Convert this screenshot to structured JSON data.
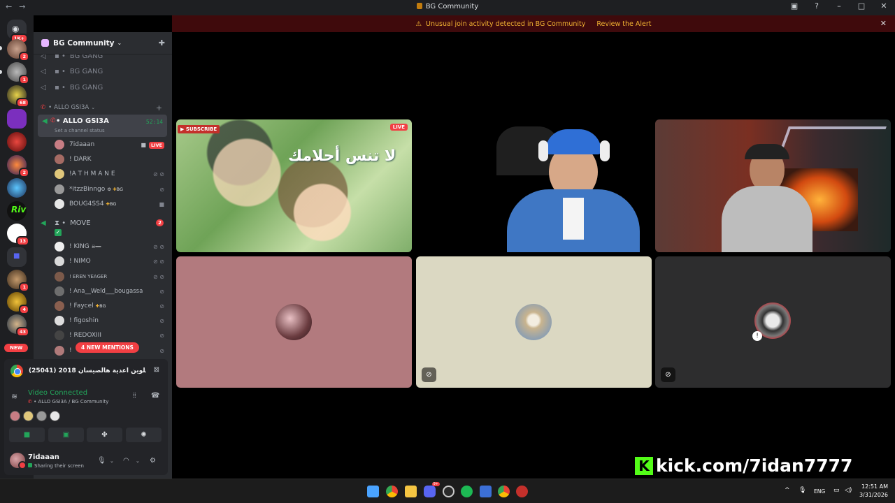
{
  "window": {
    "title": "BG Community"
  },
  "alert": {
    "text": "Unusual join activity detected in BG Community",
    "action": "Review the Alert"
  },
  "guilds": {
    "home_badge": "1K+",
    "badges": [
      "2",
      "1",
      "68",
      "2",
      "13",
      "1",
      "4",
      "43"
    ],
    "new_label": "NEW"
  },
  "server": {
    "name": "BG Community"
  },
  "channels": {
    "voice": [
      "BG GANG",
      "BG GANG",
      "BG GANG"
    ],
    "category": "ALLO GSI3A",
    "active": {
      "name": "ALLO GSI3A",
      "status": "Set a channel status",
      "timer": "52:14"
    },
    "move": {
      "name": "MOVE",
      "badge": "2"
    }
  },
  "users_allo": [
    {
      "name": "7idaaan",
      "live": "LIVE"
    },
    {
      "name": "! DARK"
    },
    {
      "name": "!A T H M A N E"
    },
    {
      "name": "*itzzBinngo",
      "tag": "BG"
    },
    {
      "name": "BOUG4SS4",
      "tag": "BG"
    }
  ],
  "users_move": [
    {
      "name": "! KING"
    },
    {
      "name": "! NIMO"
    },
    {
      "name": "! EREN YEAGER"
    },
    {
      "name": "! Ana__Weld___bougassa"
    },
    {
      "name": "! Faycel",
      "tag": "BG"
    },
    {
      "name": "! figoshin"
    },
    {
      "name": "! REDOXIII"
    },
    {
      "name": "!"
    }
  ],
  "mentions": "4 NEW MENTIONS",
  "stream": {
    "title": "(25041) 2018 شو حلوين اعدية هالصيسان ..."
  },
  "voice_status": {
    "title": "Video Connected",
    "subtitle": "ALLO GSI3A / BG Community"
  },
  "me": {
    "name": "7idaaan",
    "status": "Sharing their screen"
  },
  "tiles": {
    "subscribe": "SUBSCRIBE",
    "live": "LIVE",
    "arabic_text": "لا تنس أحلامك"
  },
  "overlay": {
    "kick_text": "kick.com/7idan7777"
  },
  "taskbar": {
    "lang": "ENG",
    "time": "12:51 AM",
    "date": "3/31/2026",
    "discord_badge": "9+"
  },
  "colors": {
    "accent": "#23a55a",
    "danger": "#f23f43",
    "kick": "#53fc18"
  }
}
